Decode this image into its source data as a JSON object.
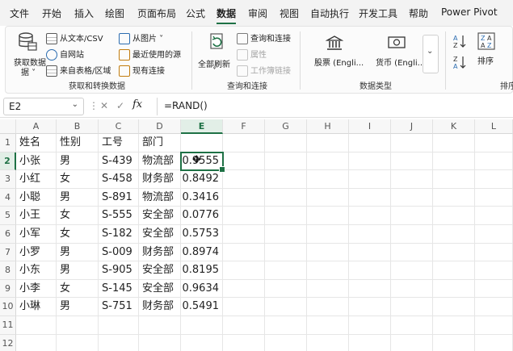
{
  "menu": {
    "tabs": [
      "文件",
      "开始",
      "插入",
      "绘图",
      "页面布局",
      "公式",
      "数据",
      "审阅",
      "视图",
      "自动执行",
      "开发工具",
      "帮助",
      "Power Pivot"
    ],
    "active_tab": "数据"
  },
  "ribbon": {
    "get_data_label": "获取数据",
    "get_data_caret": "据 ˅",
    "from_text_csv": "从文本/CSV",
    "from_web": "自网站",
    "from_table_range": "来自表格/区域",
    "from_picture": "从图片 ˅",
    "recent_sources": "最近使用的源",
    "existing_connections": "现有连接",
    "group_get_transform": "获取和转换数据",
    "refresh_all": "全部刷新",
    "queries_connections": "查询和连接",
    "properties": "属性",
    "workbook_links": "工作簿链接",
    "group_queries": "查询和连接",
    "stocks": "股票 (Engli...",
    "currencies": "货币 (Engli...",
    "group_data_types": "数据类型",
    "sort_label": "排序",
    "group_sort_partial": "排序"
  },
  "formula_bar": {
    "name_box": "E2",
    "formula": "=RAND()",
    "fx": "fx"
  },
  "sheet": {
    "columns": [
      "A",
      "B",
      "C",
      "D",
      "E",
      "F",
      "G",
      "H",
      "I",
      "J",
      "K",
      "L"
    ],
    "row_numbers": [
      "1",
      "2",
      "3",
      "4",
      "5",
      "6",
      "7",
      "8",
      "9",
      "10",
      "11",
      "12"
    ],
    "header_row": [
      "姓名",
      "性别",
      "工号",
      "部门"
    ],
    "rows": [
      [
        "小张",
        "男",
        "S-439",
        "物流部",
        "0.9555"
      ],
      [
        "小红",
        "女",
        "S-458",
        "财务部",
        "0.8492"
      ],
      [
        "小聪",
        "男",
        "S-891",
        "物流部",
        "0.3416"
      ],
      [
        "小王",
        "女",
        "S-555",
        "安全部",
        "0.0776"
      ],
      [
        "小军",
        "女",
        "S-182",
        "安全部",
        "0.5753"
      ],
      [
        "小罗",
        "男",
        "S-009",
        "财务部",
        "0.8974"
      ],
      [
        "小东",
        "男",
        "S-905",
        "安全部",
        "0.8195"
      ],
      [
        "小李",
        "女",
        "S-145",
        "安全部",
        "0.9634"
      ],
      [
        "小琳",
        "男",
        "S-751",
        "财务部",
        "0.5491"
      ]
    ],
    "selected_cell": "E2",
    "accent_color": "#1e7145"
  }
}
